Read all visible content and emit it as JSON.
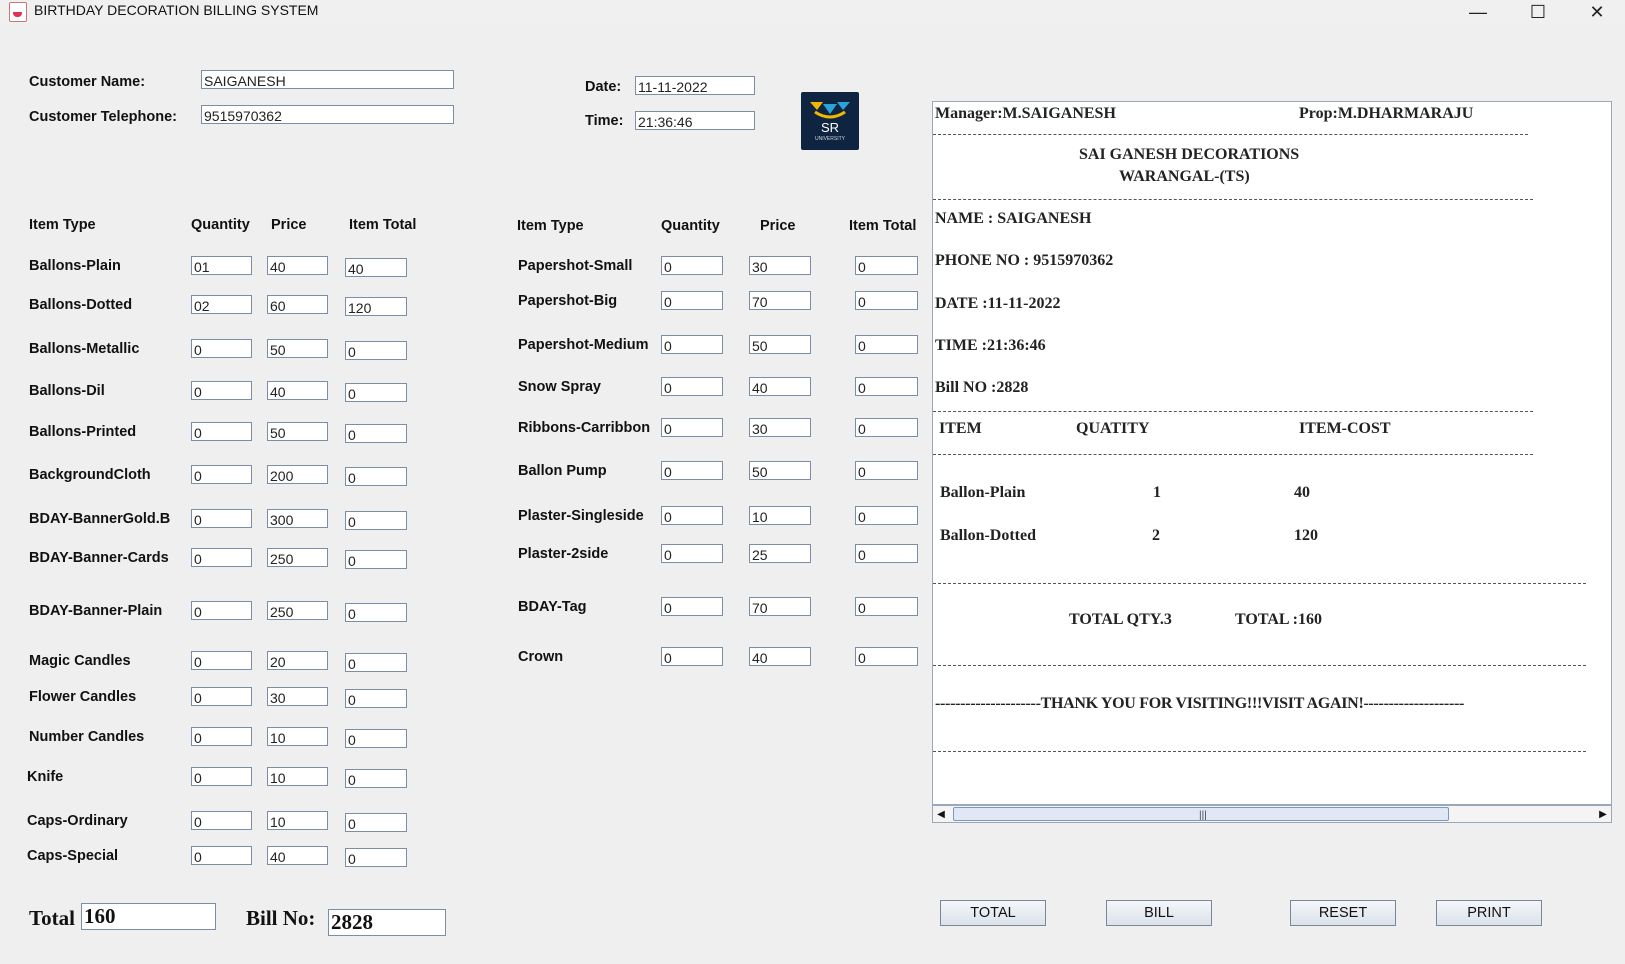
{
  "window": {
    "title": "BIRTHDAY DECORATION BILLING  SYSTEM"
  },
  "customer": {
    "name_label": "Customer Name:",
    "name_value": "SAIGANESH",
    "phone_label": "Customer Telephone:",
    "phone_value": "9515970362"
  },
  "datetime": {
    "date_label": "Date:",
    "date_value": "11-11-2022",
    "time_label": "Time:",
    "time_value": "21:36:46"
  },
  "logo": {
    "text": "SR",
    "subtext": "UNIVERSITY"
  },
  "headers": {
    "item_type": "Item Type",
    "quantity": "Quantity",
    "price": "Price",
    "item_total": "Item Total"
  },
  "items_left": [
    {
      "name": "Ballons-Plain",
      "qty": "01",
      "price": "40",
      "total": "40"
    },
    {
      "name": "Ballons-Dotted",
      "qty": "02",
      "price": "60",
      "total": "120"
    },
    {
      "name": "Ballons-Metallic",
      "qty": "0",
      "price": "50",
      "total": "0"
    },
    {
      "name": "Ballons-Dil",
      "qty": "0",
      "price": "40",
      "total": "0"
    },
    {
      "name": "Ballons-Printed",
      "qty": "0",
      "price": "50",
      "total": "0"
    },
    {
      "name": "BackgroundCloth",
      "qty": "0",
      "price": "200",
      "total": "0"
    },
    {
      "name": "BDAY-BannerGold.B",
      "qty": "0",
      "price": "300",
      "total": "0"
    },
    {
      "name": "BDAY-Banner-Cards",
      "qty": "0",
      "price": "250",
      "total": "0"
    },
    {
      "name": "BDAY-Banner-Plain",
      "qty": "0",
      "price": "250",
      "total": "0"
    },
    {
      "name": "Magic Candles",
      "qty": "0",
      "price": "20",
      "total": "0"
    },
    {
      "name": "Flower Candles",
      "qty": "0",
      "price": "30",
      "total": "0"
    },
    {
      "name": "Number Candles",
      "qty": "0",
      "price": "10",
      "total": "0"
    },
    {
      "name": "Knife",
      "qty": "0",
      "price": "10",
      "total": "0"
    },
    {
      "name": "Caps-Ordinary",
      "qty": "0",
      "price": "10",
      "total": "0"
    },
    {
      "name": "Caps-Special",
      "qty": "0",
      "price": "40",
      "total": "0"
    }
  ],
  "items_right": [
    {
      "name": "Papershot-Small",
      "qty": "0",
      "price": "30",
      "total": "0"
    },
    {
      "name": "Papershot-Big",
      "qty": "0",
      "price": "70",
      "total": "0"
    },
    {
      "name": "Papershot-Medium",
      "qty": "0",
      "price": "50",
      "total": "0"
    },
    {
      "name": "Snow Spray",
      "qty": "0",
      "price": "40",
      "total": "0"
    },
    {
      "name": "Ribbons-Carribbon",
      "qty": "0",
      "price": "30",
      "total": "0"
    },
    {
      "name": "Ballon Pump",
      "qty": "0",
      "price": "50",
      "total": "0"
    },
    {
      "name": "Plaster-Singleside",
      "qty": "0",
      "price": "10",
      "total": "0"
    },
    {
      "name": "Plaster-2side",
      "qty": "0",
      "price": "25",
      "total": "0"
    },
    {
      "name": "BDAY-Tag",
      "qty": "0",
      "price": "70",
      "total": "0"
    },
    {
      "name": "Crown",
      "qty": "0",
      "price": "40",
      "total": "0"
    }
  ],
  "bill": {
    "manager": "Manager:M.SAIGANESH",
    "prop": "Prop:M.DHARMARAJU",
    "shop_name": "SAI GANESH DECORATIONS",
    "shop_city": "WARANGAL-(TS)",
    "name_line": "NAME  : SAIGANESH",
    "phone_line": "PHONE NO : 9515970362",
    "date_line": "DATE  :11-11-2022",
    "time_line": "TIME  :21:36:46",
    "billno_line": "Bill NO  :2828",
    "col_item": "ITEM",
    "col_qty": "QUATITY",
    "col_cost": "ITEM-COST",
    "lines": [
      {
        "item": "Ballon-Plain",
        "qty": "1",
        "cost": "40"
      },
      {
        "item": "Ballon-Dotted",
        "qty": "2",
        "cost": "120"
      }
    ],
    "total_qty": "TOTAL QTY.3",
    "total": "TOTAL :160",
    "thanks": "---------------------THANK YOU FOR VISITING!!!VISIT AGAIN!--------------------"
  },
  "footer": {
    "total_label": "Total",
    "total_value": "160",
    "billno_label": "Bill No:",
    "billno_value": "2828"
  },
  "buttons": {
    "total": "TOTAL",
    "bill": "BILL",
    "reset": "RESET",
    "print": "PRINT"
  }
}
